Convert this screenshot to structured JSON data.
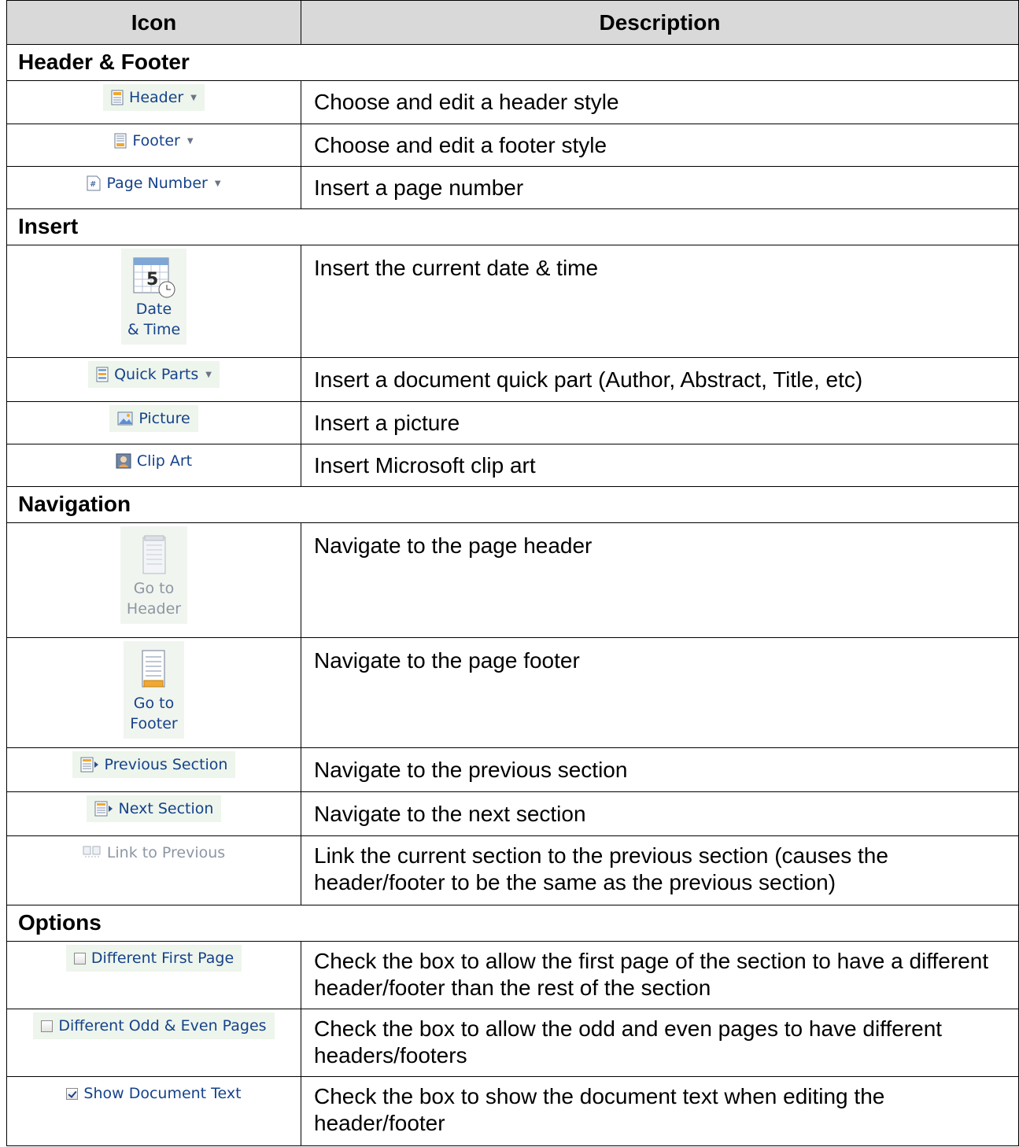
{
  "header": {
    "col1": "Icon",
    "col2": "Description"
  },
  "sections": [
    {
      "title": "Header & Footer",
      "rows": [
        {
          "icon_label": "Header",
          "icon_name": "header-icon",
          "description": "Choose and edit a header style"
        },
        {
          "icon_label": "Footer",
          "icon_name": "footer-icon",
          "description": "Choose and edit a footer style"
        },
        {
          "icon_label": "Page Number",
          "icon_name": "page-number-icon",
          "description": "Insert a page number"
        }
      ]
    },
    {
      "title": "Insert",
      "rows": [
        {
          "icon_label_line1": "Date",
          "icon_label_line2": "& Time",
          "icon_name": "calendar-clock-icon",
          "description": "Insert the current date & time"
        },
        {
          "icon_label": "Quick Parts",
          "icon_name": "quick-parts-icon",
          "description": "Insert a document quick part (Author, Abstract, Title, etc)"
        },
        {
          "icon_label": "Picture",
          "icon_name": "picture-icon",
          "description": "Insert a picture"
        },
        {
          "icon_label": "Clip Art",
          "icon_name": "clip-art-icon",
          "description": "Insert Microsoft clip art"
        }
      ]
    },
    {
      "title": "Navigation",
      "rows": [
        {
          "icon_label_line1": "Go to",
          "icon_label_line2": "Header",
          "icon_name": "go-to-header-icon",
          "description": "Navigate to the page header"
        },
        {
          "icon_label_line1": "Go to",
          "icon_label_line2": "Footer",
          "icon_name": "go-to-footer-icon",
          "description": "Navigate to the page footer"
        },
        {
          "icon_label": "Previous Section",
          "icon_name": "previous-section-icon",
          "description": "Navigate to the previous section"
        },
        {
          "icon_label": "Next Section",
          "icon_name": "next-section-icon",
          "description": "Navigate to the next section"
        },
        {
          "icon_label": "Link to Previous",
          "icon_name": "link-to-previous-icon",
          "description": "Link the current section to the previous section (causes the header/footer to be the same as the previous section)"
        }
      ]
    },
    {
      "title": "Options",
      "rows": [
        {
          "icon_label": "Different First Page",
          "icon_name": "checkbox-icon",
          "checked": false,
          "description": "Check the box to allow the first page of the section to have a different header/footer than the rest of the section"
        },
        {
          "icon_label": "Different Odd & Even Pages",
          "icon_name": "checkbox-icon",
          "checked": false,
          "description": "Check the box to allow the odd and even pages to have different headers/footers"
        },
        {
          "icon_label": "Show Document Text",
          "icon_name": "checkbox-icon",
          "checked": true,
          "description": "Check the box to show the document text when editing the header/footer"
        }
      ]
    }
  ]
}
